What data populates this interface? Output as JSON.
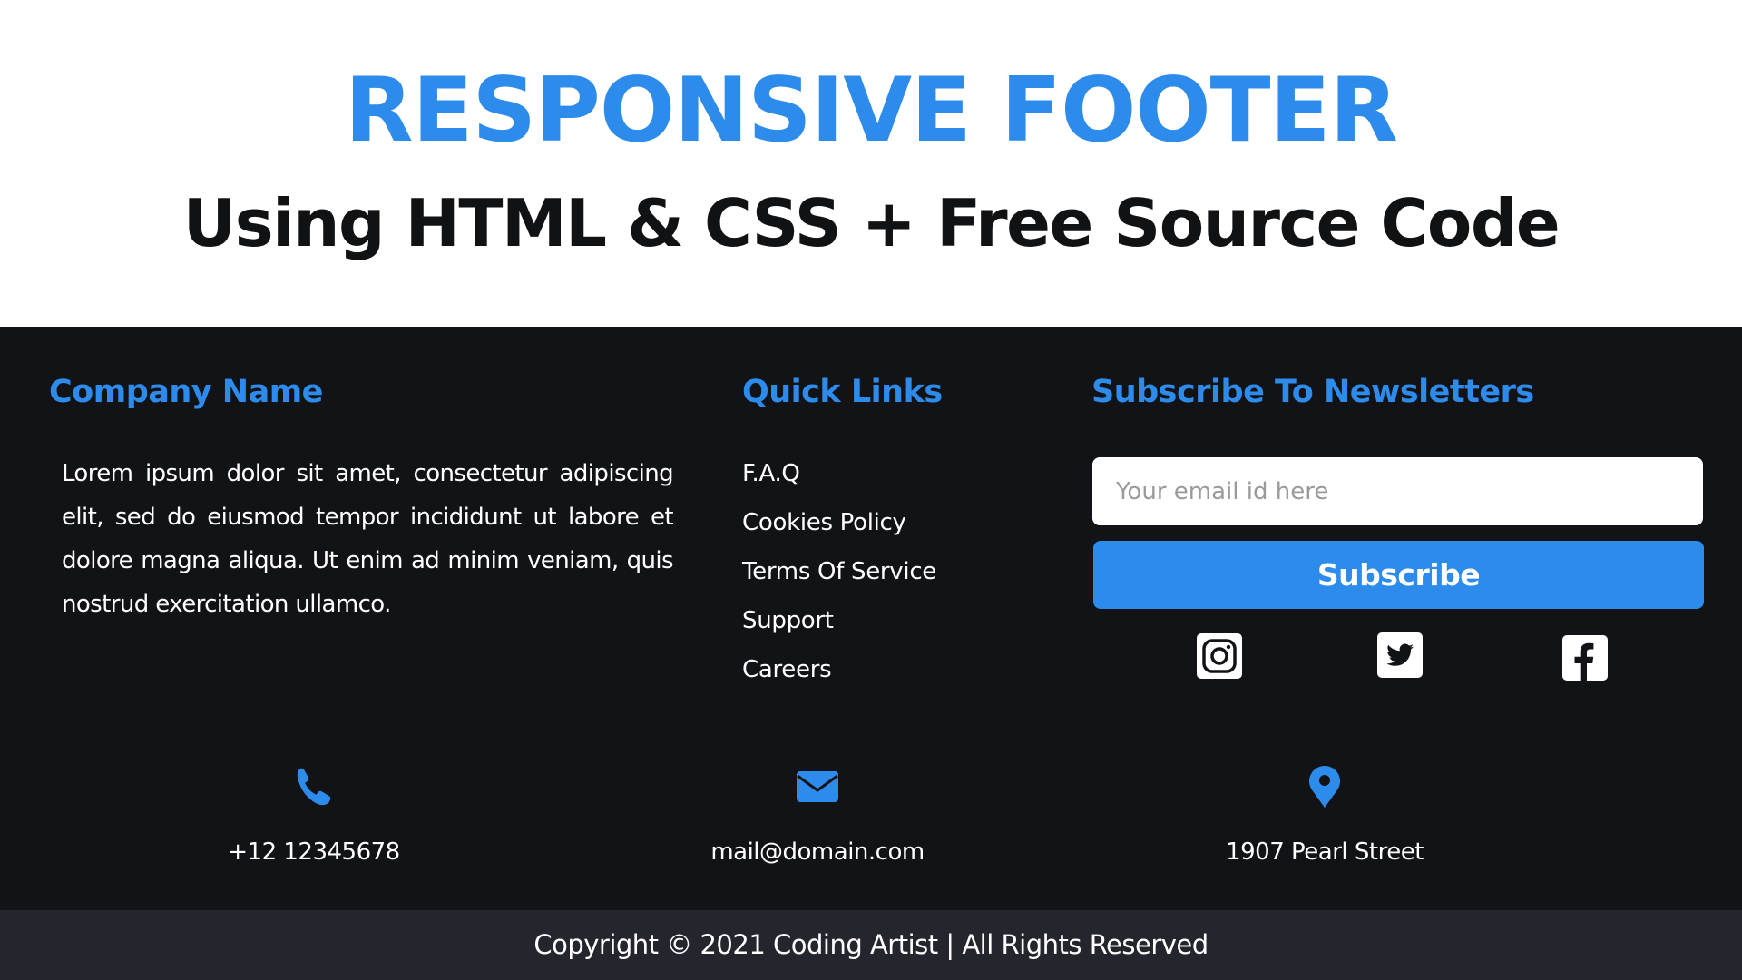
{
  "hero": {
    "title": "RESPONSIVE FOOTER",
    "subtitle": "Using HTML & CSS + Free Source Code"
  },
  "colors": {
    "accent": "#2d8ceb",
    "footer_bg": "#121316",
    "copyright_bg": "#24252d",
    "text_light": "#ffffff",
    "title_dark": "#111214"
  },
  "company": {
    "heading": "Company Name",
    "description": "Lorem ipsum dolor sit amet, consectetur adipiscing elit, sed do eiusmod tempor incididunt ut labore et dolore magna aliqua. Ut enim ad minim veniam, quis nostrud exercitation ullamco."
  },
  "quick_links": {
    "heading": "Quick Links",
    "items": [
      {
        "label": "F.A.Q"
      },
      {
        "label": "Cookies Policy"
      },
      {
        "label": "Terms Of Service"
      },
      {
        "label": "Support"
      },
      {
        "label": "Careers"
      }
    ]
  },
  "newsletter": {
    "heading": "Subscribe To Newsletters",
    "email_value": "",
    "email_placeholder": "Your email id here",
    "button_label": "Subscribe",
    "social": [
      {
        "name": "instagram",
        "icon": "instagram-icon"
      },
      {
        "name": "twitter",
        "icon": "twitter-icon"
      },
      {
        "name": "facebook",
        "icon": "facebook-icon"
      }
    ]
  },
  "contacts": [
    {
      "icon": "phone-icon",
      "text": "+12 12345678"
    },
    {
      "icon": "envelope-icon",
      "text": "mail@domain.com"
    },
    {
      "icon": "map-pin-icon",
      "text": "1907 Pearl Street"
    }
  ],
  "copyright": {
    "text": "Copyright © 2021 Coding Artist | All Rights Reserved"
  }
}
